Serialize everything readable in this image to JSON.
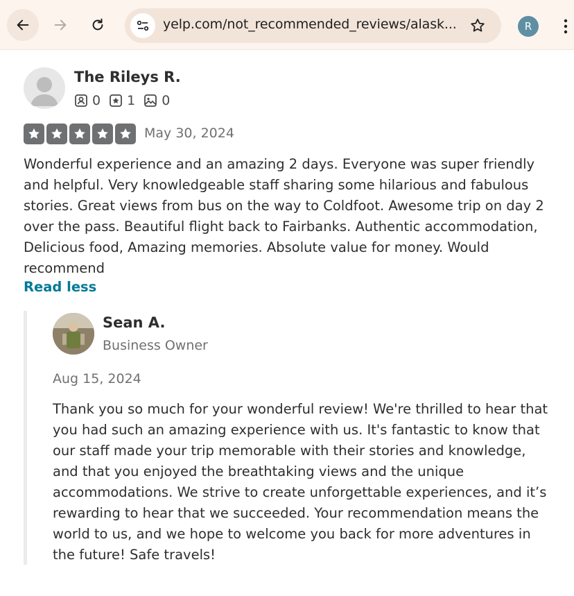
{
  "browser": {
    "url": "yelp.com/not_recommended_reviews/alask...",
    "profile_initial": "R",
    "icons": [
      "back-arrow-icon",
      "forward-arrow-icon",
      "reload-icon",
      "site-info-icon",
      "bookmark-star-icon",
      "kebab-menu-icon"
    ]
  },
  "review": {
    "user_name": "The Rileys R.",
    "friends_count": "0",
    "reviews_count": "1",
    "photos_count": "0",
    "rating": 5,
    "date": "May 30, 2024",
    "text": "Wonderful experience and an amazing 2 days. Everyone was super friendly and helpful. Very knowledgeable staff sharing some hilarious and fabulous stories. Great views from bus on the way to Coldfoot. Awesome trip on day 2 over the pass. Beautiful flight back to Fairbanks. Authentic accommodation, Delicious food, Amazing memories. Absolute value for money. Would recommend",
    "read_less_label": "Read less"
  },
  "reply": {
    "owner_name": "Sean A.",
    "owner_role": "Business Owner",
    "date": "Aug 15, 2024",
    "text": "Thank you so much for your wonderful review! We're thrilled to hear that you had such an amazing experience with us. It's fantastic to know that our staff made your trip memorable with their stories and knowledge, and that you enjoyed the breathtaking views and the unique accommodations. We strive to create unforgettable experiences, and it’s rewarding to hear that we succeeded. Your recommendation means the world to us, and we hope to welcome you back for more adventures in the future! Safe travels!"
  },
  "colors": {
    "star_fill": "#6e7072",
    "link": "#027a97",
    "toolbar_bg": "#fdf4ee"
  }
}
